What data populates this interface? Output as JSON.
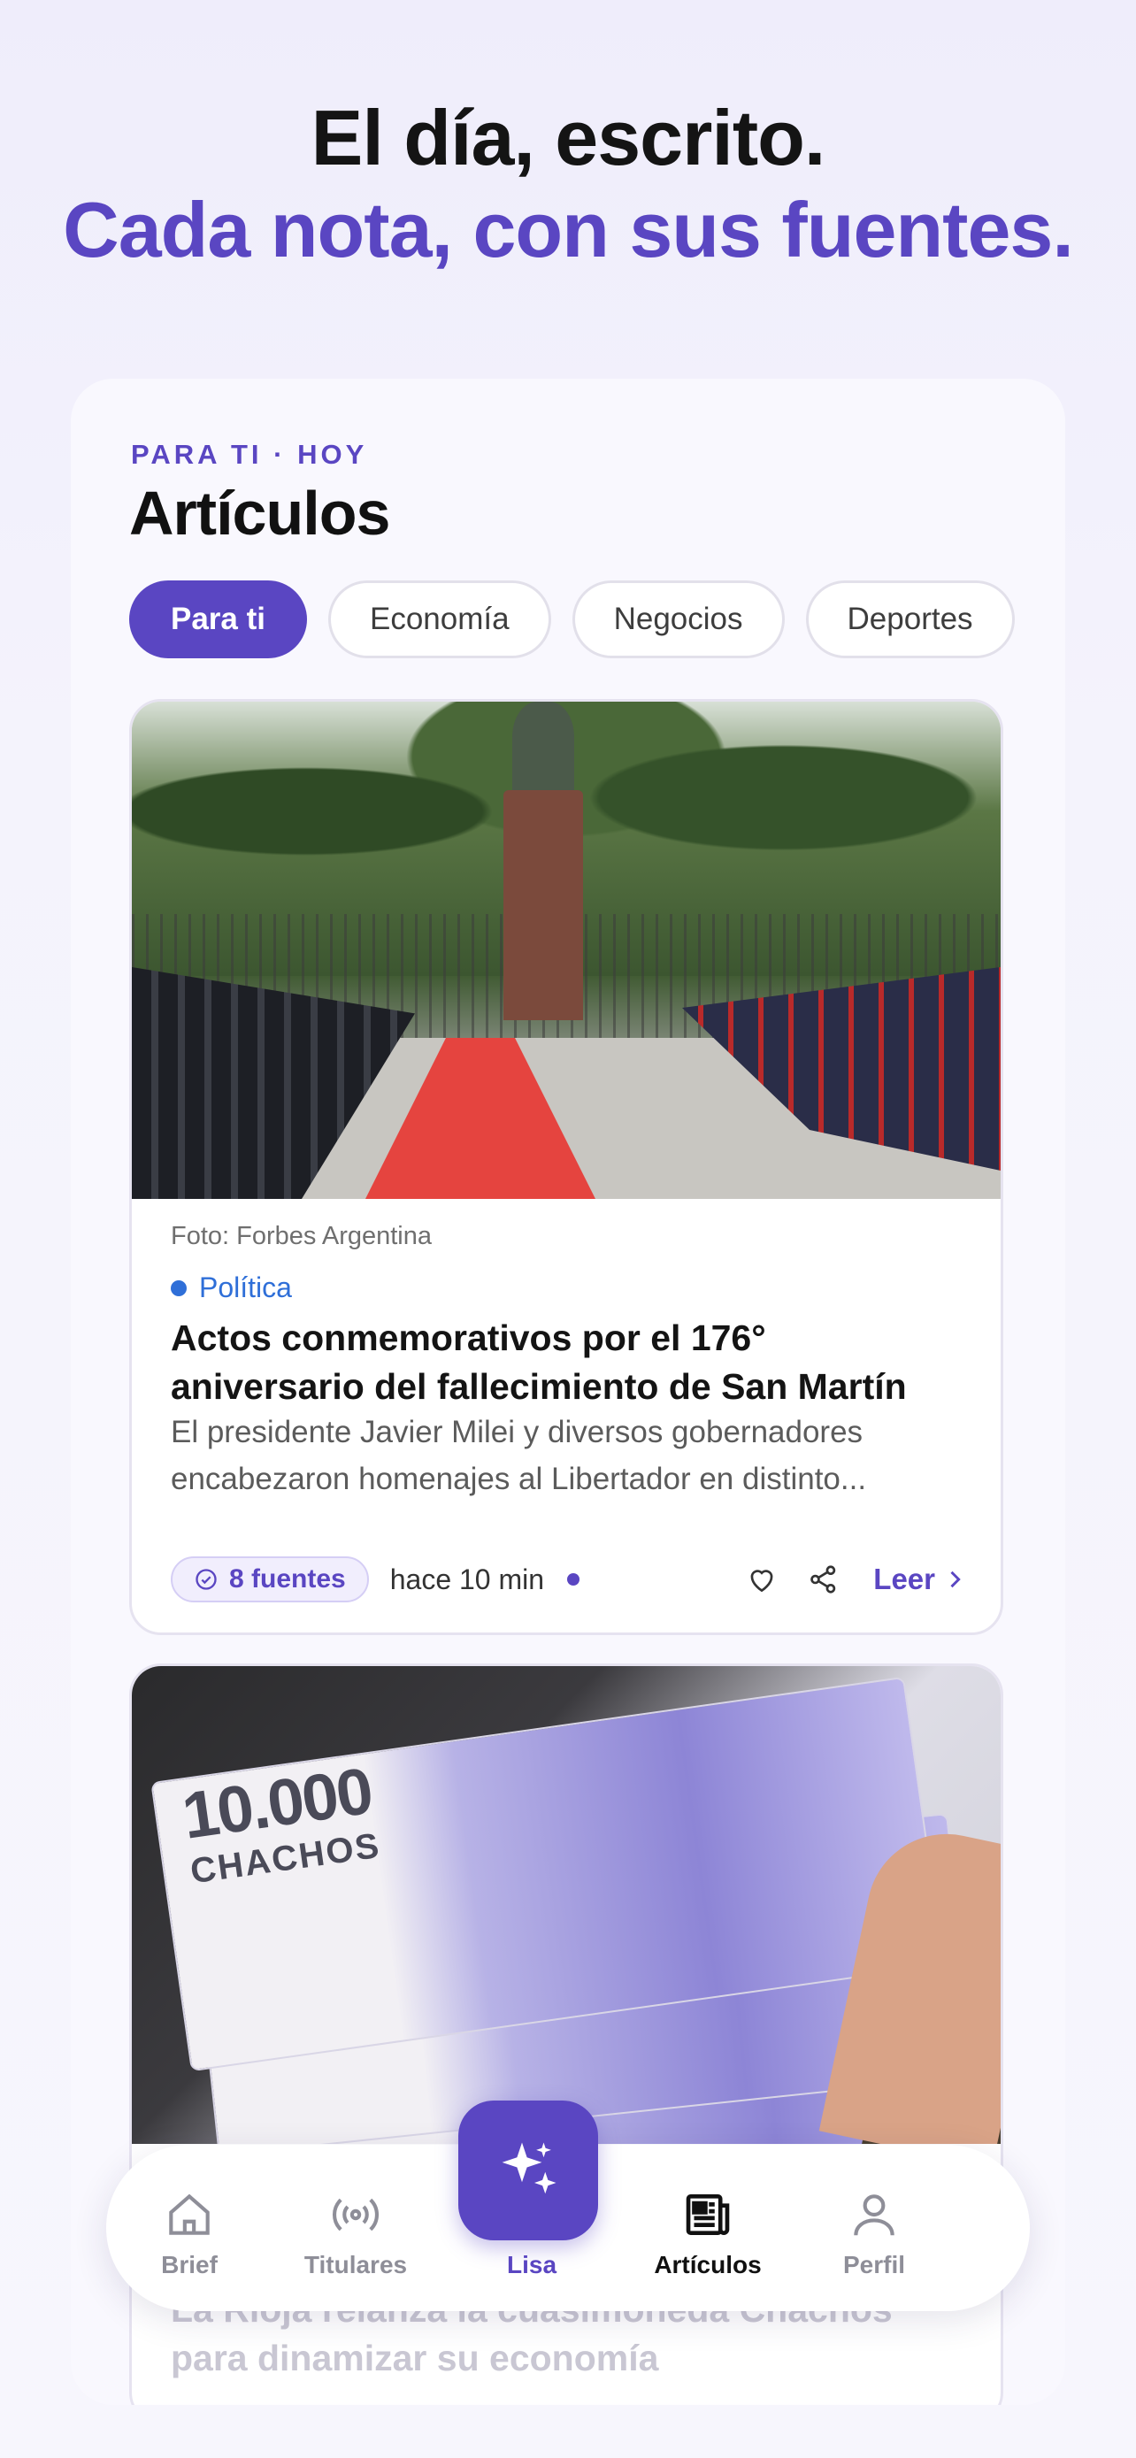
{
  "hero": {
    "line1": "El día, escrito.",
    "line2": "Cada nota, con sus fuentes."
  },
  "panel": {
    "eyebrow": "PARA TI · HOY",
    "title": "Artículos",
    "chips": [
      "Para ti",
      "Economía",
      "Negocios",
      "Deportes"
    ]
  },
  "article1": {
    "credit": "Foto: Forbes Argentina",
    "category": "Política",
    "headline": "Actos conmemorativos por el 176° aniversario del fallecimiento de San Martín",
    "summary": "El presidente Javier Milei y diversos gobernadores encabezaron homenajes al Libertador en distinto...",
    "sources": "8 fuentes",
    "time": "hace 10 min",
    "read": "Leer"
  },
  "article2": {
    "bill_number": "10.000",
    "bill_name": "CHACHOS",
    "headline": "La Rioja relanza la cuasimoneda Chachos para dinamizar su economía"
  },
  "tabbar": {
    "brief": "Brief",
    "titulares": "Titulares",
    "lisa": "Lisa",
    "articulos": "Artículos",
    "perfil": "Perfil"
  },
  "colors": {
    "accent": "#5a46c2",
    "category": "#2f6fd8"
  }
}
